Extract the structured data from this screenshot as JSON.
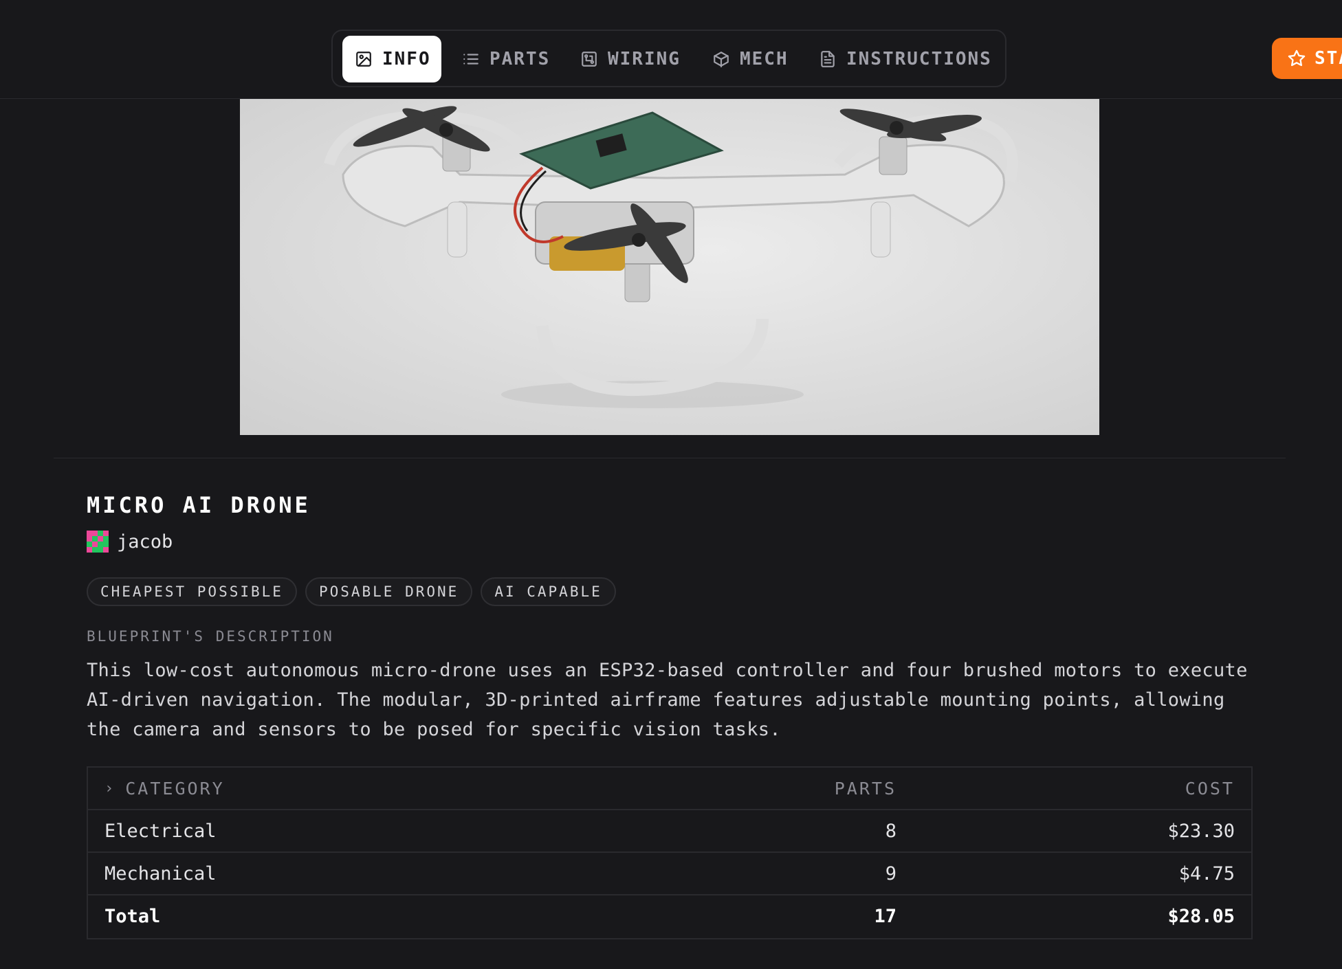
{
  "tabs": [
    {
      "label": "INFO",
      "icon": "image-icon",
      "active": true
    },
    {
      "label": "PARTS",
      "icon": "list-icon",
      "active": false
    },
    {
      "label": "WIRING",
      "icon": "circuit-icon",
      "active": false
    },
    {
      "label": "MECH",
      "icon": "cube-icon",
      "active": false
    },
    {
      "label": "INSTRUCTIONS",
      "icon": "document-icon",
      "active": false
    }
  ],
  "star_button": {
    "label": "STA",
    "icon": "star-icon",
    "color": "#f97316"
  },
  "project": {
    "title": "MICRO AI DRONE",
    "author": "jacob",
    "tags": [
      "CHEAPEST POSSIBLE",
      "POSABLE DRONE",
      "AI CAPABLE"
    ],
    "description_label": "BLUEPRINT'S DESCRIPTION",
    "description": "This low-cost autonomous micro-drone uses an ESP32-based controller and four brushed motors to execute AI-driven navigation. The modular, 3D-printed airframe features adjustable mounting points, allowing the camera and sensors to be posed for specific vision tasks."
  },
  "table": {
    "headers": {
      "category": "CATEGORY",
      "parts": "PARTS",
      "cost": "COST"
    },
    "rows": [
      {
        "category": "Electrical",
        "parts": "8",
        "cost": "$23.30"
      },
      {
        "category": "Mechanical",
        "parts": "9",
        "cost": "$4.75"
      }
    ],
    "total": {
      "category": "Total",
      "parts": "17",
      "cost": "$28.05"
    }
  },
  "colors": {
    "background": "#18181b",
    "accent": "#f97316",
    "border": "#2a2a2e",
    "avatar": [
      "#ec4899",
      "#22c55e"
    ]
  }
}
